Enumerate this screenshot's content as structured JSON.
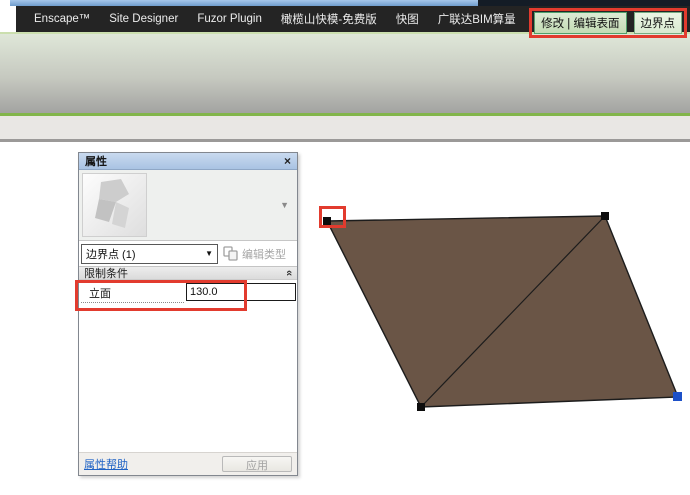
{
  "menu": {
    "items": [
      "Enscape™",
      "Site Designer",
      "Fuzor Plugin",
      "橄榄山快模-免费版",
      "快图",
      "广联达BIM算量"
    ]
  },
  "tabs": {
    "modify_edit_surface": "修改 | 编辑表面",
    "boundary_point": "边界点"
  },
  "properties_panel": {
    "title": "属性",
    "close_icon": "×",
    "type_selector": {
      "value": "边界点 (1)",
      "dropdown_icon": "▼",
      "preview_arrow_icon": "▼"
    },
    "edit_type_label": "编辑类型",
    "section_header": "限制条件",
    "collapse_icon": "«",
    "constraints": {
      "label": "立面",
      "value": "130.0"
    },
    "help_link": "属性帮助",
    "apply_button": "应用"
  },
  "colors": {
    "annotation_red": "#e23b2e",
    "surface_brown": "#6a5546",
    "selected_point_blue": "#1d50c8",
    "panel_title_blue": "#b9cde8",
    "active_tab_green": "#cfe3c4"
  }
}
